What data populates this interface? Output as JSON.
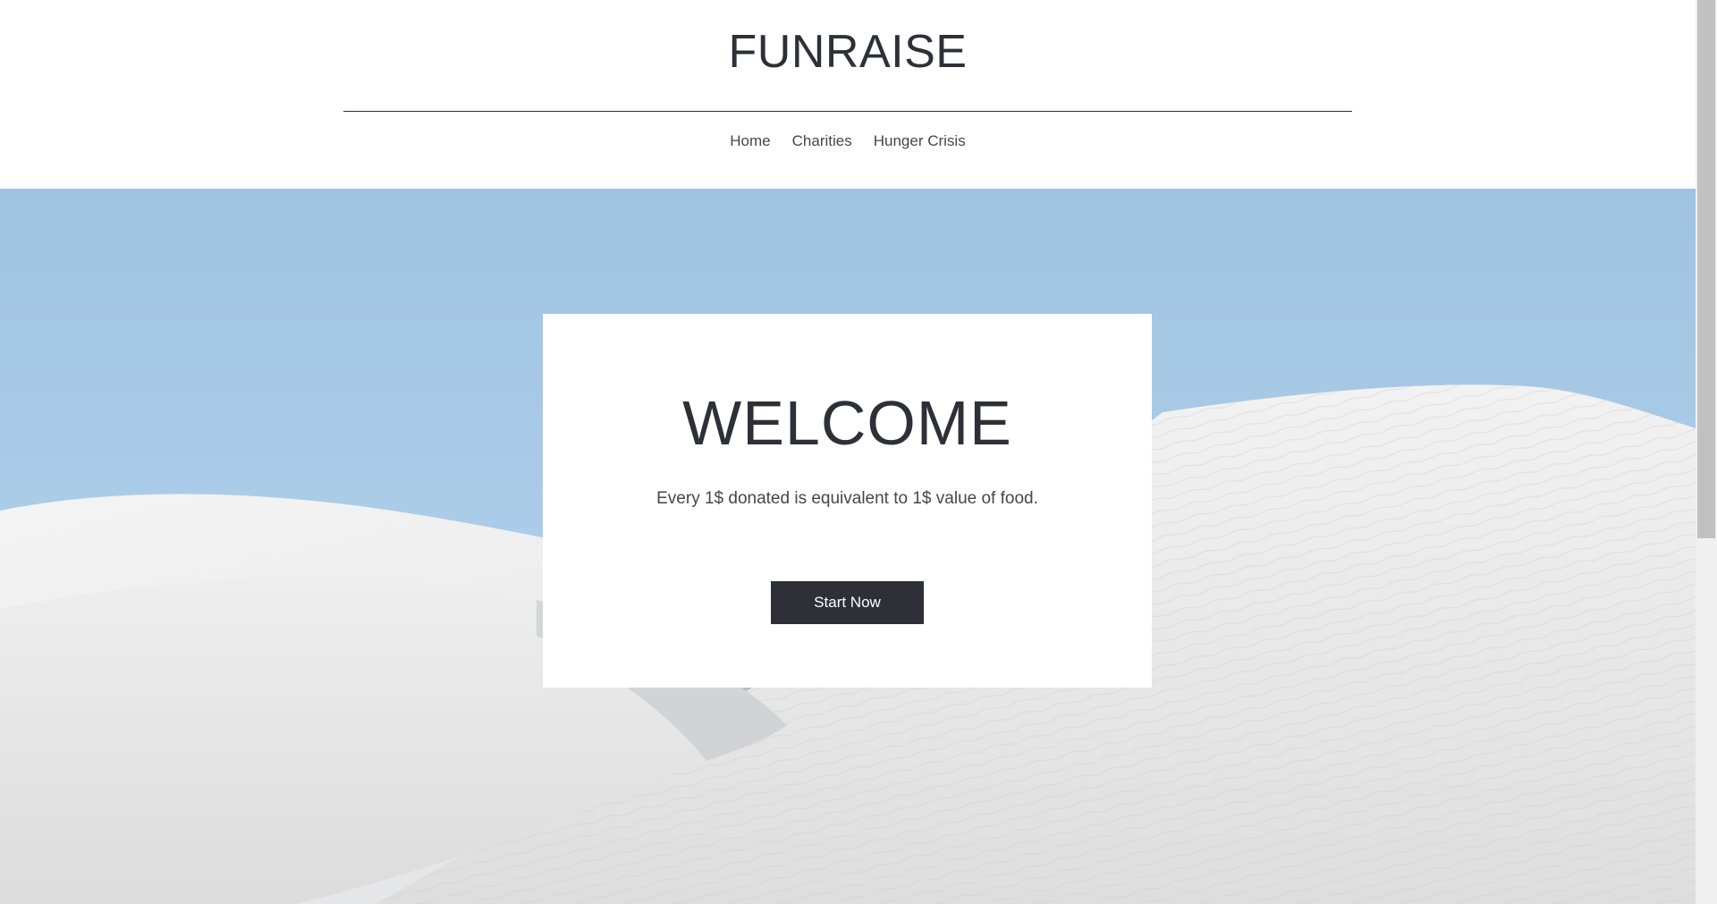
{
  "header": {
    "site_title": "FUNRAISE",
    "nav": [
      {
        "label": "Home"
      },
      {
        "label": "Charities"
      },
      {
        "label": "Hunger Crisis"
      }
    ]
  },
  "hero": {
    "background": "white-sand-dunes-under-blue-sky",
    "card": {
      "title": "WELCOME",
      "text": "Every 1$ donated is equivalent to 1$ value of food.",
      "button_label": "Start Now"
    }
  },
  "colors": {
    "text_dark": "#2f3037",
    "button_bg": "#2f3037",
    "button_text": "#ffffff",
    "sky": "#a3c6e3"
  }
}
